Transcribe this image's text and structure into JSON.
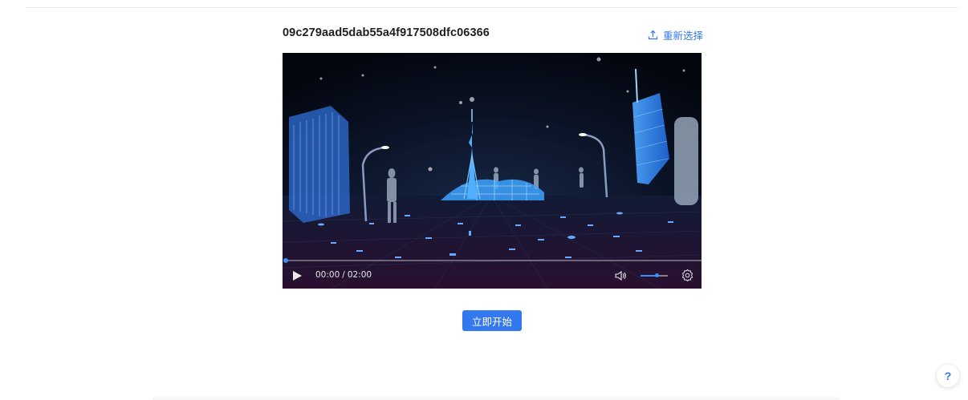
{
  "file": {
    "name": "09c279aad5dab55a4f917508dfc06366"
  },
  "reselect": {
    "label": "重新选择",
    "icon": "upload-icon"
  },
  "video": {
    "current_time": "00:00",
    "separator": "/",
    "duration": "02:00",
    "progress_fraction": 0.0,
    "volume_fraction": 0.6,
    "icons": [
      "play-icon",
      "volume-icon",
      "settings-icon"
    ]
  },
  "start_button": {
    "label": "立即开始"
  },
  "help": {
    "label": "?"
  },
  "colors": {
    "accent": "#3478f0",
    "progress": "#3a8ef6",
    "video_bg": "#060b18"
  }
}
